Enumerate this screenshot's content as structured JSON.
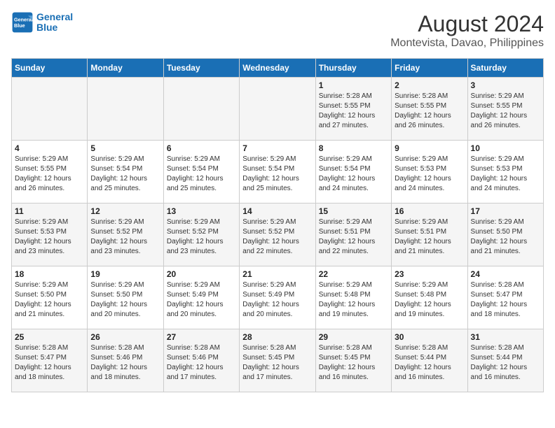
{
  "logo": {
    "line1": "General",
    "line2": "Blue"
  },
  "title": "August 2024",
  "subtitle": "Montevista, Davao, Philippines",
  "days_of_week": [
    "Sunday",
    "Monday",
    "Tuesday",
    "Wednesday",
    "Thursday",
    "Friday",
    "Saturday"
  ],
  "weeks": [
    [
      {
        "day": "",
        "info": ""
      },
      {
        "day": "",
        "info": ""
      },
      {
        "day": "",
        "info": ""
      },
      {
        "day": "",
        "info": ""
      },
      {
        "day": "1",
        "info": "Sunrise: 5:28 AM\nSunset: 5:55 PM\nDaylight: 12 hours\nand 27 minutes."
      },
      {
        "day": "2",
        "info": "Sunrise: 5:28 AM\nSunset: 5:55 PM\nDaylight: 12 hours\nand 26 minutes."
      },
      {
        "day": "3",
        "info": "Sunrise: 5:29 AM\nSunset: 5:55 PM\nDaylight: 12 hours\nand 26 minutes."
      }
    ],
    [
      {
        "day": "4",
        "info": "Sunrise: 5:29 AM\nSunset: 5:55 PM\nDaylight: 12 hours\nand 26 minutes."
      },
      {
        "day": "5",
        "info": "Sunrise: 5:29 AM\nSunset: 5:54 PM\nDaylight: 12 hours\nand 25 minutes."
      },
      {
        "day": "6",
        "info": "Sunrise: 5:29 AM\nSunset: 5:54 PM\nDaylight: 12 hours\nand 25 minutes."
      },
      {
        "day": "7",
        "info": "Sunrise: 5:29 AM\nSunset: 5:54 PM\nDaylight: 12 hours\nand 25 minutes."
      },
      {
        "day": "8",
        "info": "Sunrise: 5:29 AM\nSunset: 5:54 PM\nDaylight: 12 hours\nand 24 minutes."
      },
      {
        "day": "9",
        "info": "Sunrise: 5:29 AM\nSunset: 5:53 PM\nDaylight: 12 hours\nand 24 minutes."
      },
      {
        "day": "10",
        "info": "Sunrise: 5:29 AM\nSunset: 5:53 PM\nDaylight: 12 hours\nand 24 minutes."
      }
    ],
    [
      {
        "day": "11",
        "info": "Sunrise: 5:29 AM\nSunset: 5:53 PM\nDaylight: 12 hours\nand 23 minutes."
      },
      {
        "day": "12",
        "info": "Sunrise: 5:29 AM\nSunset: 5:52 PM\nDaylight: 12 hours\nand 23 minutes."
      },
      {
        "day": "13",
        "info": "Sunrise: 5:29 AM\nSunset: 5:52 PM\nDaylight: 12 hours\nand 23 minutes."
      },
      {
        "day": "14",
        "info": "Sunrise: 5:29 AM\nSunset: 5:52 PM\nDaylight: 12 hours\nand 22 minutes."
      },
      {
        "day": "15",
        "info": "Sunrise: 5:29 AM\nSunset: 5:51 PM\nDaylight: 12 hours\nand 22 minutes."
      },
      {
        "day": "16",
        "info": "Sunrise: 5:29 AM\nSunset: 5:51 PM\nDaylight: 12 hours\nand 21 minutes."
      },
      {
        "day": "17",
        "info": "Sunrise: 5:29 AM\nSunset: 5:50 PM\nDaylight: 12 hours\nand 21 minutes."
      }
    ],
    [
      {
        "day": "18",
        "info": "Sunrise: 5:29 AM\nSunset: 5:50 PM\nDaylight: 12 hours\nand 21 minutes."
      },
      {
        "day": "19",
        "info": "Sunrise: 5:29 AM\nSunset: 5:50 PM\nDaylight: 12 hours\nand 20 minutes."
      },
      {
        "day": "20",
        "info": "Sunrise: 5:29 AM\nSunset: 5:49 PM\nDaylight: 12 hours\nand 20 minutes."
      },
      {
        "day": "21",
        "info": "Sunrise: 5:29 AM\nSunset: 5:49 PM\nDaylight: 12 hours\nand 20 minutes."
      },
      {
        "day": "22",
        "info": "Sunrise: 5:29 AM\nSunset: 5:48 PM\nDaylight: 12 hours\nand 19 minutes."
      },
      {
        "day": "23",
        "info": "Sunrise: 5:29 AM\nSunset: 5:48 PM\nDaylight: 12 hours\nand 19 minutes."
      },
      {
        "day": "24",
        "info": "Sunrise: 5:28 AM\nSunset: 5:47 PM\nDaylight: 12 hours\nand 18 minutes."
      }
    ],
    [
      {
        "day": "25",
        "info": "Sunrise: 5:28 AM\nSunset: 5:47 PM\nDaylight: 12 hours\nand 18 minutes."
      },
      {
        "day": "26",
        "info": "Sunrise: 5:28 AM\nSunset: 5:46 PM\nDaylight: 12 hours\nand 18 minutes."
      },
      {
        "day": "27",
        "info": "Sunrise: 5:28 AM\nSunset: 5:46 PM\nDaylight: 12 hours\nand 17 minutes."
      },
      {
        "day": "28",
        "info": "Sunrise: 5:28 AM\nSunset: 5:45 PM\nDaylight: 12 hours\nand 17 minutes."
      },
      {
        "day": "29",
        "info": "Sunrise: 5:28 AM\nSunset: 5:45 PM\nDaylight: 12 hours\nand 16 minutes."
      },
      {
        "day": "30",
        "info": "Sunrise: 5:28 AM\nSunset: 5:44 PM\nDaylight: 12 hours\nand 16 minutes."
      },
      {
        "day": "31",
        "info": "Sunrise: 5:28 AM\nSunset: 5:44 PM\nDaylight: 12 hours\nand 16 minutes."
      }
    ]
  ]
}
